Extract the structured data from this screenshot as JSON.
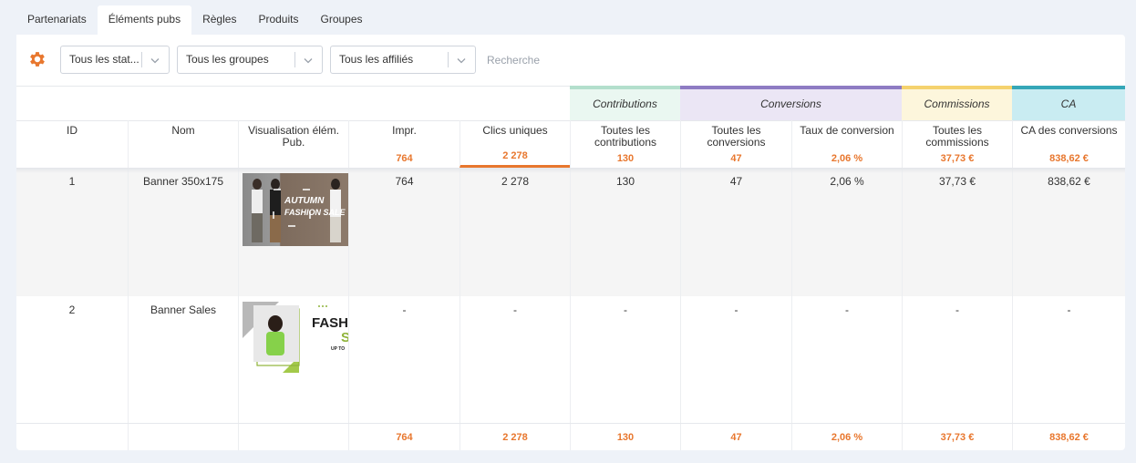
{
  "tabs": [
    {
      "label": "Partenariats",
      "active": false
    },
    {
      "label": "Éléments pubs",
      "active": true
    },
    {
      "label": "Règles",
      "active": false
    },
    {
      "label": "Produits",
      "active": false
    },
    {
      "label": "Groupes",
      "active": false
    }
  ],
  "toolbar": {
    "settings_icon": "gear-icon",
    "status_select": "Tous les stat...",
    "group_select": "Tous les groupes",
    "affiliate_select": "Tous les affiliés",
    "search_placeholder": "Recherche"
  },
  "column_groups": [
    {
      "label": "Contributions",
      "color": "#b3dfcc",
      "bg": "#eaf7f1"
    },
    {
      "label": "Conversions",
      "color": "#8e7cc3",
      "bg": "#ebe6f5"
    },
    {
      "label": "Commissions",
      "color": "#f5d26e",
      "bg": "#fdf6dc"
    },
    {
      "label": "CA",
      "color": "#35a7b8",
      "bg": "#c9ecf2"
    }
  ],
  "columns": [
    {
      "label": "ID",
      "total": ""
    },
    {
      "label": "Nom",
      "total": ""
    },
    {
      "label": "Visualisation élém. Pub.",
      "total": ""
    },
    {
      "label": "Impr.",
      "total": "764"
    },
    {
      "label": "Clics uniques",
      "total": "2 278"
    },
    {
      "label": "Toutes les contributions",
      "total": "130"
    },
    {
      "label": "Toutes les conversions",
      "total": "47"
    },
    {
      "label": "Taux de conversion",
      "total": "2,06 %"
    },
    {
      "label": "Toutes les commissions",
      "total": "37,73 €"
    },
    {
      "label": "CA des conversions",
      "total": "838,62 €"
    }
  ],
  "rows": [
    {
      "id": "1",
      "name": "Banner 350x175",
      "banner_text_1": "AUTUMN",
      "banner_text_2": "FASHION SALE",
      "impr": "764",
      "clicks": "2 278",
      "contributions": "130",
      "conversions": "47",
      "rate": "2,06 %",
      "commissions": "37,73 €",
      "ca": "838,62 €"
    },
    {
      "id": "2",
      "name": "Banner Sales",
      "banner_text_1": "FASH",
      "banner_text_2": "S",
      "banner_text_3": "UP TO",
      "impr": "-",
      "clicks": "-",
      "contributions": "-",
      "conversions": "-",
      "rate": "-",
      "commissions": "-",
      "ca": "-"
    }
  ],
  "footer": {
    "impr": "764",
    "clicks": "2 278",
    "contributions": "130",
    "conversions": "47",
    "rate": "2,06 %",
    "commissions": "37,73 €",
    "ca": "838,62 €"
  },
  "accent_color": "#e8772e"
}
